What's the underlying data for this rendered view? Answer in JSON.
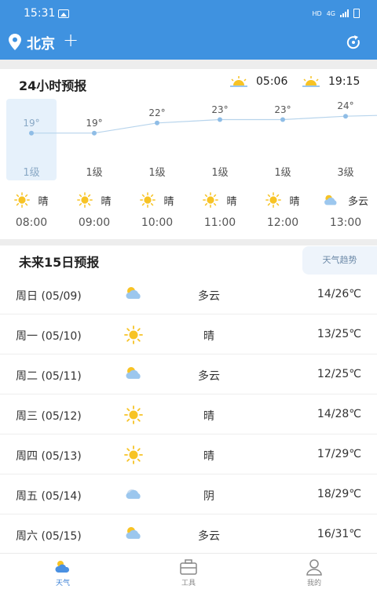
{
  "status_bar": {
    "time": "15:31",
    "hd": "HD",
    "network": "4G"
  },
  "header": {
    "city": "北京",
    "add_symbol": "+"
  },
  "hourly": {
    "title": "24小时预报",
    "sunrise": "05:06",
    "sunset": "19:15",
    "items": [
      {
        "time": "08:00",
        "temp": "19°",
        "temp_value": 19,
        "level": "1级",
        "condition": "晴",
        "icon": "sun-icon"
      },
      {
        "time": "09:00",
        "temp": "19°",
        "temp_value": 19,
        "level": "1级",
        "condition": "晴",
        "icon": "sun-icon"
      },
      {
        "time": "10:00",
        "temp": "22°",
        "temp_value": 22,
        "level": "1级",
        "condition": "晴",
        "icon": "sun-icon"
      },
      {
        "time": "11:00",
        "temp": "23°",
        "temp_value": 23,
        "level": "1级",
        "condition": "晴",
        "icon": "sun-icon"
      },
      {
        "time": "12:00",
        "temp": "23°",
        "temp_value": 23,
        "level": "1级",
        "condition": "晴",
        "icon": "sun-icon"
      },
      {
        "time": "13:00",
        "temp": "24°",
        "temp_value": 24,
        "level": "3级",
        "condition": "多云",
        "icon": "cloudy-icon"
      }
    ]
  },
  "daily": {
    "title": "未来15日预报",
    "trend_button": "天气趋势",
    "items": [
      {
        "date": "周日 (05/09)",
        "condition": "多云",
        "range": "14/26℃",
        "icon": "cloudy-icon"
      },
      {
        "date": "周一 (05/10)",
        "condition": "晴",
        "range": "13/25℃",
        "icon": "sun-icon"
      },
      {
        "date": "周二 (05/11)",
        "condition": "多云",
        "range": "12/25℃",
        "icon": "cloudy-icon"
      },
      {
        "date": "周三 (05/12)",
        "condition": "晴",
        "range": "14/28℃",
        "icon": "sun-icon"
      },
      {
        "date": "周四 (05/13)",
        "condition": "晴",
        "range": "17/29℃",
        "icon": "sun-icon"
      },
      {
        "date": "周五 (05/14)",
        "condition": "阴",
        "range": "18/29℃",
        "icon": "overcast-icon"
      },
      {
        "date": "周六 (05/15)",
        "condition": "多云",
        "range": "16/31℃",
        "icon": "cloudy-icon"
      }
    ]
  },
  "nav": {
    "weather": "天气",
    "tools": "工具",
    "mine": "我的"
  },
  "colors": {
    "header_bg": "#3f92e0",
    "accent": "#3a7fd5",
    "sun": "#f7c325",
    "cloud": "#9cc7ee"
  }
}
